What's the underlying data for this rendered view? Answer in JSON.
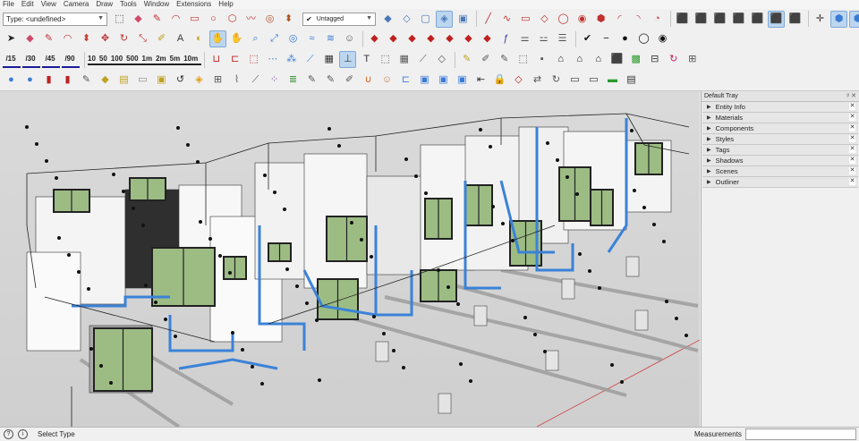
{
  "menu": [
    "File",
    "Edit",
    "View",
    "Camera",
    "Draw",
    "Tools",
    "Window",
    "Extensions",
    "Help"
  ],
  "type_selector": {
    "value": "Type: <undefined>"
  },
  "tag_selector": {
    "value": "Untagged"
  },
  "row1_icons": [
    {
      "name": "select-icon",
      "glyph": "⬚",
      "color": "#333"
    },
    {
      "name": "eraser-icon",
      "glyph": "◆",
      "color": "#d04a6a"
    },
    {
      "name": "line-icon",
      "glyph": "✎",
      "color": "#c03030"
    },
    {
      "name": "arc-icon",
      "glyph": "◠",
      "color": "#c03030"
    },
    {
      "name": "rectangle-icon",
      "glyph": "▭",
      "color": "#c03030"
    },
    {
      "name": "circle-icon",
      "glyph": "○",
      "color": "#c03030"
    },
    {
      "name": "polygon-icon",
      "glyph": "⬡",
      "color": "#c03030"
    },
    {
      "name": "freehand-icon",
      "glyph": "〰",
      "color": "#c03030"
    },
    {
      "name": "offset-icon",
      "glyph": "◎",
      "color": "#b05020"
    },
    {
      "name": "pushpull-icon",
      "glyph": "⬍",
      "color": "#b05020"
    }
  ],
  "row1_iso_icons": [
    {
      "name": "iso-view-icon",
      "glyph": "◆",
      "color": "#4a78b8"
    },
    {
      "name": "top-view-icon",
      "glyph": "◇",
      "color": "#4a78b8"
    },
    {
      "name": "front-view-icon",
      "glyph": "▢",
      "color": "#4a78b8"
    },
    {
      "name": "right-view-icon",
      "glyph": "◈",
      "color": "#4a78b8"
    },
    {
      "name": "back-view-icon",
      "glyph": "▣",
      "color": "#4a78b8"
    }
  ],
  "row1_draw_icons": [
    {
      "name": "pencil-icon",
      "glyph": "╱",
      "color": "#c03030"
    },
    {
      "name": "spline-icon",
      "glyph": "∿",
      "color": "#c03030"
    },
    {
      "name": "rect-draw-icon",
      "glyph": "▭",
      "color": "#c03030"
    },
    {
      "name": "rotated-rect-icon",
      "glyph": "◇",
      "color": "#c03030"
    },
    {
      "name": "circle-draw-icon",
      "glyph": "◯",
      "color": "#c03030"
    },
    {
      "name": "target-icon",
      "glyph": "◉",
      "color": "#c03030"
    },
    {
      "name": "polygon-draw-icon",
      "glyph": "⬢",
      "color": "#c03030"
    },
    {
      "name": "arc2-icon",
      "glyph": "◜",
      "color": "#c03030"
    },
    {
      "name": "arc3-icon",
      "glyph": "◝",
      "color": "#c03030"
    },
    {
      "name": "pie-icon",
      "glyph": "◔",
      "color": "#c03030"
    }
  ],
  "row1_style_icons": [
    {
      "name": "xray-icon",
      "glyph": "⬛",
      "color": "#555"
    },
    {
      "name": "backedges-icon",
      "glyph": "⬛",
      "color": "#555"
    },
    {
      "name": "wireframe-icon",
      "glyph": "⬛",
      "color": "#555"
    },
    {
      "name": "hiddenline-icon",
      "glyph": "⬛",
      "color": "#555"
    },
    {
      "name": "shaded-icon",
      "glyph": "⬛",
      "color": "#555"
    },
    {
      "name": "textured-icon",
      "glyph": "⬛",
      "color": "#555"
    },
    {
      "name": "monochrome-icon",
      "glyph": "⬛",
      "color": "#555"
    }
  ],
  "row1_right_icons": [
    {
      "name": "axes-icon",
      "glyph": "✛",
      "color": "#333"
    },
    {
      "name": "section-plane-icon",
      "glyph": "⬢",
      "color": "#3a7bd5"
    },
    {
      "name": "section-cut-icon",
      "glyph": "⬢",
      "color": "#3a7bd5"
    },
    {
      "name": "section-fill-icon",
      "glyph": "⬢",
      "color": "#3a7bd5"
    },
    {
      "name": "warehouse-icon",
      "glyph": "◉",
      "color": "#c02020"
    },
    {
      "name": "layers-stack-icon",
      "glyph": "≣",
      "color": "#7040a0"
    },
    {
      "name": "brick-wall-icon",
      "glyph": "▦",
      "color": "#888"
    },
    {
      "name": "stack-icon",
      "glyph": "◈",
      "color": "#555"
    },
    {
      "name": "grid-icon",
      "glyph": "▦",
      "color": "#555"
    }
  ],
  "row2_icons": [
    {
      "name": "arrow-select-icon",
      "glyph": "➤",
      "color": "#222"
    },
    {
      "name": "eraser2-icon",
      "glyph": "◆",
      "color": "#d04a6a"
    },
    {
      "name": "pencil2-icon",
      "glyph": "✎",
      "color": "#c03030"
    },
    {
      "name": "arc4-icon",
      "glyph": "◠",
      "color": "#c03030"
    },
    {
      "name": "push-icon",
      "glyph": "⬍",
      "color": "#c04030"
    },
    {
      "name": "move-icon",
      "glyph": "✥",
      "color": "#c03030"
    },
    {
      "name": "rotate-icon",
      "glyph": "↻",
      "color": "#c03030"
    },
    {
      "name": "scale-icon",
      "glyph": "⤡",
      "color": "#c03030"
    },
    {
      "name": "tape-icon",
      "glyph": "✐",
      "color": "#c0a020"
    },
    {
      "name": "text-tool-icon",
      "glyph": "A",
      "color": "#333"
    },
    {
      "name": "paint-bucket-icon",
      "glyph": "◐",
      "color": "#c0a020"
    },
    {
      "name": "orbit-icon",
      "glyph": "✋",
      "color": "#3a7bd5"
    },
    {
      "name": "pan-icon",
      "glyph": "✋",
      "color": "#3a7bd5"
    },
    {
      "name": "zoom-icon",
      "glyph": "⌕",
      "color": "#3a7bd5"
    },
    {
      "name": "zoom-extents-icon",
      "glyph": "⤢",
      "color": "#3a7bd5"
    },
    {
      "name": "soften-icon",
      "glyph": "◎",
      "color": "#3a7bd5"
    },
    {
      "name": "follow-me-icon",
      "glyph": "≈",
      "color": "#3a7bd5"
    },
    {
      "name": "sandbox-icon",
      "glyph": "≋",
      "color": "#3a7bd5"
    },
    {
      "name": "user-icon",
      "glyph": "☺",
      "color": "#555"
    }
  ],
  "row2_axis_icons": [
    {
      "name": "move-x-icon",
      "glyph": "◆",
      "color": "#c02020"
    },
    {
      "name": "move-y-icon",
      "glyph": "◆",
      "color": "#c02020"
    },
    {
      "name": "move-z-icon",
      "glyph": "◆",
      "color": "#c02020"
    },
    {
      "name": "rotate-x-icon",
      "glyph": "◆",
      "color": "#c02020"
    },
    {
      "name": "rotate-y-icon",
      "glyph": "◆",
      "color": "#c02020"
    },
    {
      "name": "rotate-z-icon",
      "glyph": "◆",
      "color": "#c02020"
    },
    {
      "name": "scale-xyz-icon",
      "glyph": "◆",
      "color": "#c02020"
    },
    {
      "name": "function-icon",
      "glyph": "ƒ",
      "color": "#3a3aa0"
    },
    {
      "name": "sliders-icon",
      "glyph": "⚌",
      "color": "#555"
    },
    {
      "name": "adjust-icon",
      "glyph": "⚍",
      "color": "#555"
    },
    {
      "name": "settings-lines-icon",
      "glyph": "☰",
      "color": "#555"
    }
  ],
  "row2_right_icons": [
    {
      "name": "check-circle-icon",
      "glyph": "✔",
      "color": "#111"
    },
    {
      "name": "minus-circle-icon",
      "glyph": "−",
      "color": "#111"
    },
    {
      "name": "speech-bubble-icon",
      "glyph": "●",
      "color": "#111"
    },
    {
      "name": "comment-icon",
      "glyph": "◯",
      "color": "#111"
    },
    {
      "name": "eye-icon",
      "glyph": "◉",
      "color": "#111"
    }
  ],
  "row3_dims": [
    "/15",
    "/30",
    "/45",
    "/90"
  ],
  "row3_scale": [
    "10",
    "50",
    "100",
    "500",
    "1m",
    "2m",
    "5m",
    "10m"
  ],
  "row3_icons": [
    {
      "name": "u-shape-icon",
      "glyph": "⊔",
      "color": "#c02020"
    },
    {
      "name": "bracket-icon",
      "glyph": "⊏",
      "color": "#c02020"
    },
    {
      "name": "stairs-icon",
      "glyph": "⬚",
      "color": "#c02020"
    },
    {
      "name": "dots-chain-icon",
      "glyph": "⋯",
      "color": "#3a7bd5"
    },
    {
      "name": "nodes-icon",
      "glyph": "⁂",
      "color": "#3a7bd5"
    },
    {
      "name": "line-graph-icon",
      "glyph": "⟋",
      "color": "#3a7bd5"
    },
    {
      "name": "wall-icon",
      "glyph": "▦",
      "color": "#333"
    },
    {
      "name": "column-icon",
      "glyph": "⊥",
      "color": "#333"
    },
    {
      "name": "text-label-icon",
      "glyph": "T",
      "color": "#333"
    },
    {
      "name": "select-bounds-icon",
      "glyph": "⬚",
      "color": "#555"
    },
    {
      "name": "hatch-icon",
      "glyph": "▦",
      "color": "#555"
    },
    {
      "name": "sketch-line-icon",
      "glyph": "⟋",
      "color": "#555"
    },
    {
      "name": "eraser3-icon",
      "glyph": "◇",
      "color": "#555"
    }
  ],
  "row3_right_icons": [
    {
      "name": "paint-brush-icon",
      "glyph": "✎",
      "color": "#c0a020"
    },
    {
      "name": "eyedropper-icon",
      "glyph": "✐",
      "color": "#555"
    },
    {
      "name": "pencil3-icon",
      "glyph": "✎",
      "color": "#555"
    },
    {
      "name": "crop-icon",
      "glyph": "⬚",
      "color": "#555"
    },
    {
      "name": "square-icon",
      "glyph": "▪",
      "color": "#555"
    },
    {
      "name": "house-icon",
      "glyph": "⌂",
      "color": "#111"
    },
    {
      "name": "house-outline-icon",
      "glyph": "⌂",
      "color": "#111"
    },
    {
      "name": "home-icon",
      "glyph": "⌂",
      "color": "#111"
    },
    {
      "name": "box-3d-icon",
      "glyph": "⬛",
      "color": "#c02020"
    },
    {
      "name": "color-cube-icon",
      "glyph": "▩",
      "color": "#2a9a2a"
    },
    {
      "name": "align-icon",
      "glyph": "⊟",
      "color": "#333"
    },
    {
      "name": "refresh-circle-icon",
      "glyph": "↻",
      "color": "#c02060"
    },
    {
      "name": "arrange-icon",
      "glyph": "⊞",
      "color": "#555"
    }
  ],
  "row4_icons": [
    {
      "name": "sun-shadow-icon",
      "glyph": "●",
      "color": "#3a7bd5"
    },
    {
      "name": "sun-shadow2-icon",
      "glyph": "●",
      "color": "#3a7bd5"
    },
    {
      "name": "door-icon",
      "glyph": "▮",
      "color": "#c02020"
    },
    {
      "name": "door2-icon",
      "glyph": "▮",
      "color": "#c02020"
    },
    {
      "name": "sketch-icon",
      "glyph": "✎",
      "color": "#555"
    },
    {
      "name": "tag-icon",
      "glyph": "◆",
      "color": "#c0a020"
    },
    {
      "name": "book-icon",
      "glyph": "▤",
      "color": "#c0a020"
    },
    {
      "name": "paper-icon",
      "glyph": "▭",
      "color": "#888"
    },
    {
      "name": "frame-icon",
      "glyph": "▣",
      "color": "#c0a020"
    },
    {
      "name": "rotate-left-icon",
      "glyph": "↺",
      "color": "#333"
    },
    {
      "name": "layers-orange-icon",
      "glyph": "◈",
      "color": "#e0a020"
    },
    {
      "name": "pages-icon",
      "glyph": "⊞",
      "color": "#555"
    },
    {
      "name": "paperclip-icon",
      "glyph": "⌇",
      "color": "#555"
    },
    {
      "name": "ruler-icon",
      "glyph": "⟋",
      "color": "#555"
    },
    {
      "name": "dots-grid-icon",
      "glyph": "⁘",
      "color": "#7040a0"
    },
    {
      "name": "layers-green-icon",
      "glyph": "≣",
      "color": "#2a8a2a"
    },
    {
      "name": "brush2-icon",
      "glyph": "✎",
      "color": "#555"
    },
    {
      "name": "pen-icon",
      "glyph": "✎",
      "color": "#555"
    },
    {
      "name": "pipette-icon",
      "glyph": "✐",
      "color": "#555"
    },
    {
      "name": "magnet-icon",
      "glyph": "∪",
      "color": "#e06020"
    },
    {
      "name": "person-icon",
      "glyph": "☺",
      "color": "#c08050"
    },
    {
      "name": "pipe-connect-icon",
      "glyph": "⊏",
      "color": "#3a7bd5"
    },
    {
      "name": "cube-blue-icon",
      "glyph": "▣",
      "color": "#3a7bd5"
    },
    {
      "name": "cube-blue2-icon",
      "glyph": "▣",
      "color": "#3a7bd5"
    },
    {
      "name": "cube-blue3-icon",
      "glyph": "▣",
      "color": "#3a7bd5"
    },
    {
      "name": "move-left-icon",
      "glyph": "⇤",
      "color": "#333"
    },
    {
      "name": "lock-icon",
      "glyph": "🔒",
      "color": "#c02020"
    },
    {
      "name": "diamond-icon",
      "glyph": "◇",
      "color": "#c02020"
    },
    {
      "name": "tool-swap-icon",
      "glyph": "⇄",
      "color": "#555"
    },
    {
      "name": "rotate-right-icon",
      "glyph": "↻",
      "color": "#555"
    },
    {
      "name": "card-icon",
      "glyph": "▭",
      "color": "#333"
    },
    {
      "name": "card2-icon",
      "glyph": "▭",
      "color": "#333"
    },
    {
      "name": "battery-icon",
      "glyph": "▬",
      "color": "#2a9a2a"
    },
    {
      "name": "report-icon",
      "glyph": "▤",
      "color": "#333"
    }
  ],
  "tray": {
    "title": "Default Tray",
    "panels": [
      "Entity Info",
      "Materials",
      "Components",
      "Styles",
      "Tags",
      "Shadows",
      "Scenes",
      "Outliner"
    ]
  },
  "status": {
    "text": "Select Type",
    "measurements_label": "Measurements"
  }
}
